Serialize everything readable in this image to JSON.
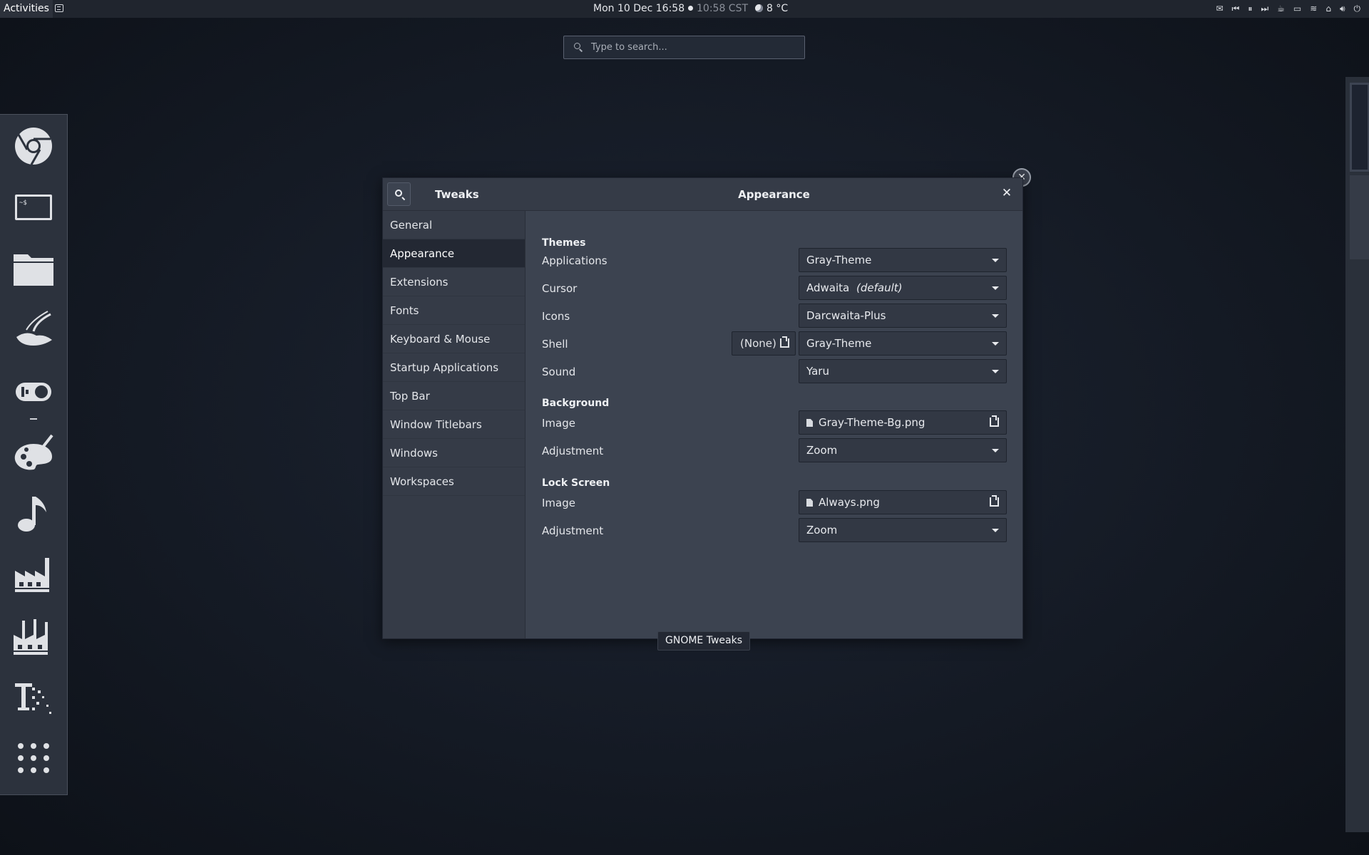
{
  "topbar": {
    "activities": "Activities",
    "clock": "Mon 10 Dec  16:58",
    "clock2": "10:58 CST",
    "weather": "8 °C"
  },
  "overview": {
    "search_placeholder": "Type to search...",
    "window_caption": "GNOME Tweaks"
  },
  "dock": {
    "items": [
      "chrome",
      "terminal",
      "files",
      "lamp",
      "tweaks-toggle",
      "paint-palette",
      "music",
      "factory",
      "factory-alt",
      "pixel-font",
      "app-grid"
    ]
  },
  "window": {
    "sidebar_title": "Tweaks",
    "content_title": "Appearance",
    "nav": [
      {
        "label": "General"
      },
      {
        "label": "Appearance"
      },
      {
        "label": "Extensions"
      },
      {
        "label": "Fonts"
      },
      {
        "label": "Keyboard & Mouse"
      },
      {
        "label": "Startup Applications"
      },
      {
        "label": "Top Bar"
      },
      {
        "label": "Window Titlebars"
      },
      {
        "label": "Windows"
      },
      {
        "label": "Workspaces"
      }
    ],
    "active_nav": "Appearance",
    "sections": {
      "themes": {
        "title": "Themes",
        "applications_label": "Applications",
        "applications_value": "Gray-Theme",
        "cursor_label": "Cursor",
        "cursor_value": "Adwaita",
        "cursor_value_suffix": "(default)",
        "icons_label": "Icons",
        "icons_value": "Darcwaita-Plus",
        "shell_label": "Shell",
        "shell_none": "(None)",
        "shell_value": "Gray-Theme",
        "sound_label": "Sound",
        "sound_value": "Yaru"
      },
      "background": {
        "title": "Background",
        "image_label": "Image",
        "image_value": "Gray-Theme-Bg.png",
        "adjustment_label": "Adjustment",
        "adjustment_value": "Zoom"
      },
      "lock_screen": {
        "title": "Lock Screen",
        "image_label": "Image",
        "image_value": "Always.png",
        "adjustment_label": "Adjustment",
        "adjustment_value": "Zoom"
      }
    }
  }
}
